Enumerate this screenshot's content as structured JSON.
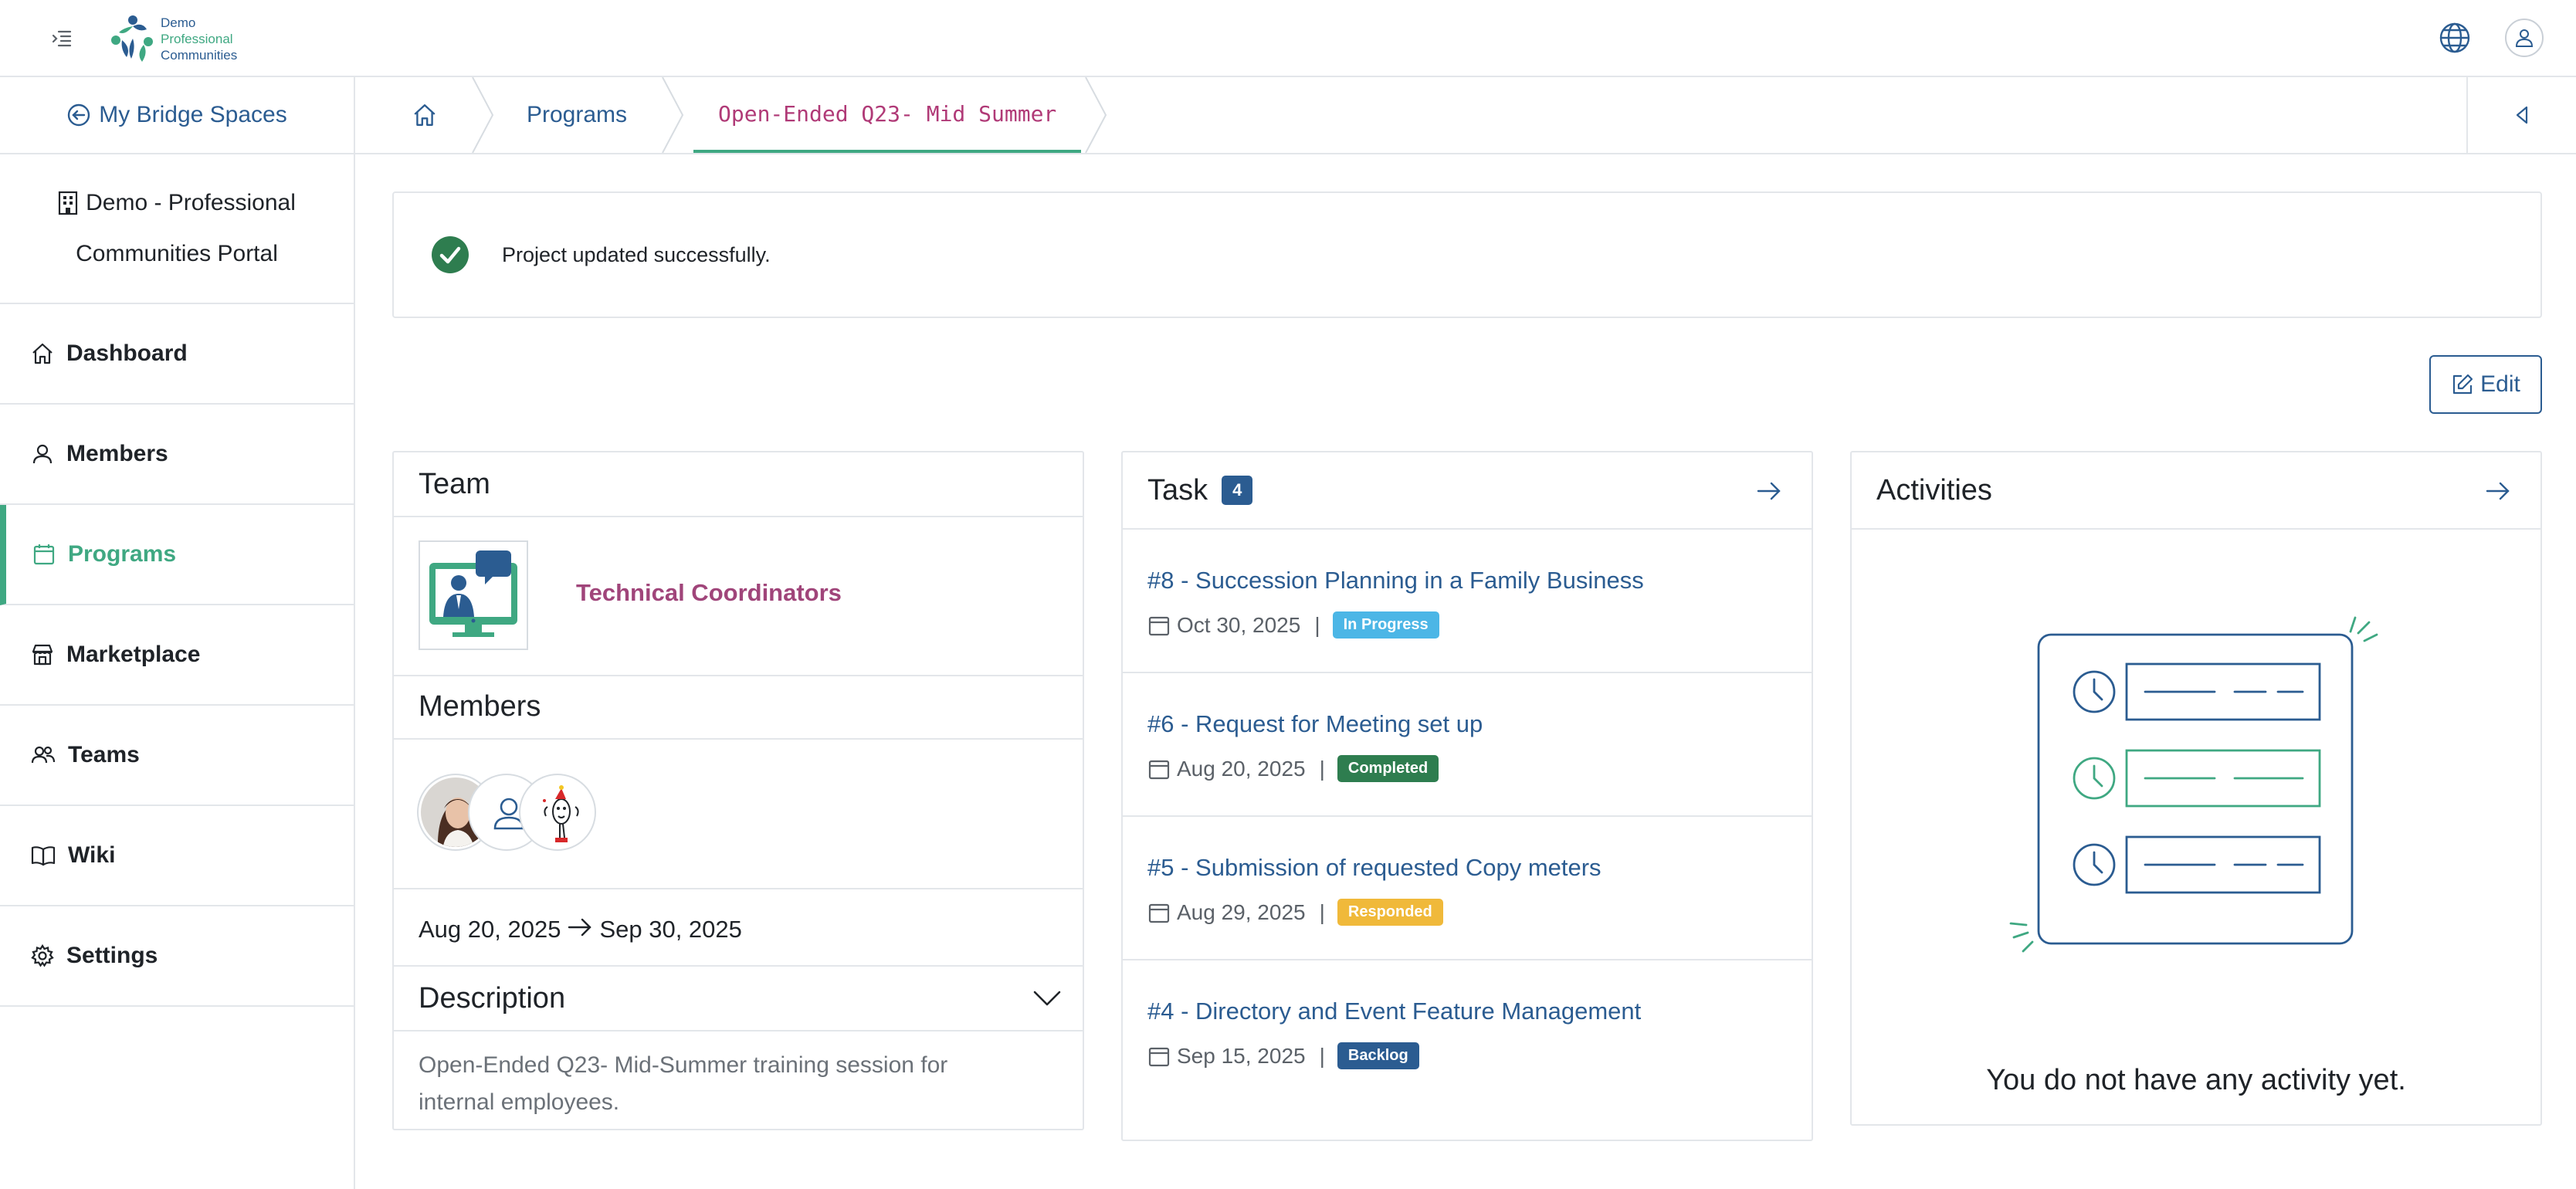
{
  "app": {
    "logo_lines": [
      "Demo",
      "Professional",
      "Communities"
    ]
  },
  "sidebar": {
    "back_label": "My Bridge Spaces",
    "portal_line1": "Demo - Professional",
    "portal_line2": "Communities Portal",
    "items": [
      {
        "label": "Dashboard",
        "icon": "home-icon"
      },
      {
        "label": "Members",
        "icon": "user-icon"
      },
      {
        "label": "Programs",
        "icon": "calendar-icon",
        "active": true
      },
      {
        "label": "Marketplace",
        "icon": "store-icon"
      },
      {
        "label": "Teams",
        "icon": "users-icon"
      },
      {
        "label": "Wiki",
        "icon": "book-icon"
      },
      {
        "label": "Settings",
        "icon": "gear-icon"
      }
    ]
  },
  "breadcrumb": {
    "items": [
      "Programs",
      "Open-Ended Q23- Mid Summer"
    ]
  },
  "alert": {
    "message": "Project updated successfully."
  },
  "toolbar": {
    "edit_label": "Edit"
  },
  "team_card": {
    "team_title": "Team",
    "team_name": "Technical Coordinators",
    "members_title": "Members",
    "date_start": "Aug 20, 2025",
    "date_end": "Sep 30, 2025",
    "description_title": "Description",
    "description_text": "Open-Ended Q23- Mid-Summer training session for internal employees."
  },
  "task_card": {
    "title": "Task",
    "count": "4",
    "tasks": [
      {
        "title": "#8 - Succession Planning in a Family Business",
        "date": "Oct 30, 2025",
        "status": "In Progress",
        "color": "#4cb6e6"
      },
      {
        "title": "#6 - Request for Meeting set up",
        "date": "Aug 20, 2025",
        "status": "Completed",
        "color": "#2e7d4f"
      },
      {
        "title": "#5 - Submission of requested Copy meters",
        "date": "Aug 29, 2025",
        "status": "Responded",
        "color": "#f0b93a"
      },
      {
        "title": "#4 - Directory and Event Feature Management",
        "date": "Sep 15, 2025",
        "status": "Backlog",
        "color": "#2b5c91"
      }
    ]
  },
  "activities_card": {
    "title": "Activities",
    "empty_text": "You do not have any activity yet."
  },
  "colors": {
    "primary": "#2b5c91",
    "accent": "#3fa882",
    "current_crumb": "#b03a77",
    "team_name": "#a0457a"
  }
}
